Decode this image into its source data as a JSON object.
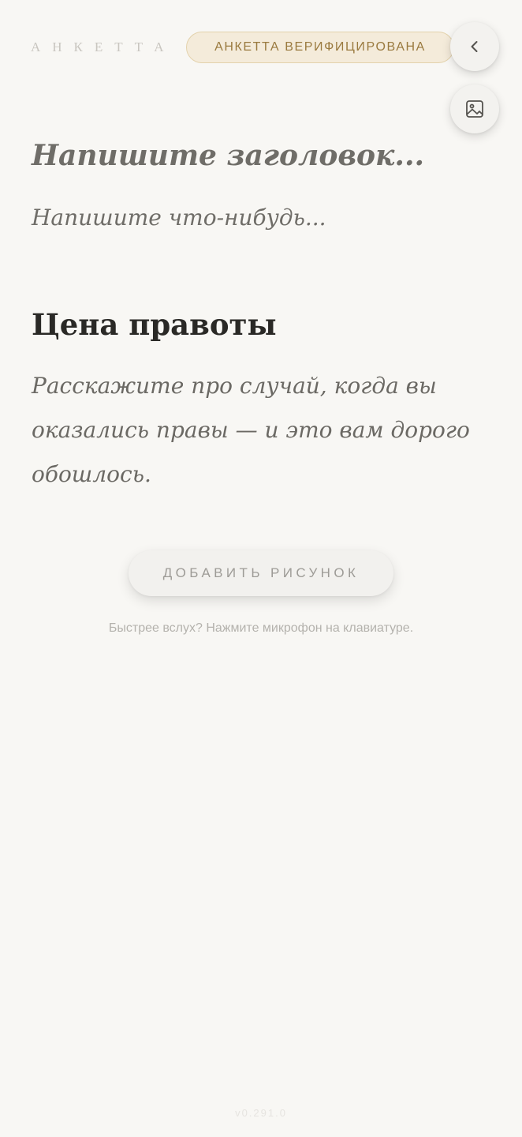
{
  "header": {
    "brand": "АНКЕТТА",
    "verified_badge": "АНКЕТТА ВЕРИФИЦИРОВАНА",
    "back_icon": "chevron-left-icon",
    "image_icon": "image-icon"
  },
  "editor": {
    "title_placeholder": "Напишите заголовок...",
    "body_placeholder": "Напишите что-нибудь..."
  },
  "prompt": {
    "title": "Цена правоты",
    "text": "Расскажите про случай, когда вы оказались правы — и это вам дорого обошлось."
  },
  "actions": {
    "add_image_label": "ДОБАВИТЬ РИСУНОК"
  },
  "hint": "Быстрее вслух? Нажмите микрофон на клавиатуре.",
  "version": "v0.291.0",
  "colors": {
    "background": "#f8f7f4",
    "badge_background": "#f4ebda",
    "badge_border": "#e3d2ac",
    "badge_text": "#9a7a3f",
    "prompt_title": "#2a2926"
  }
}
